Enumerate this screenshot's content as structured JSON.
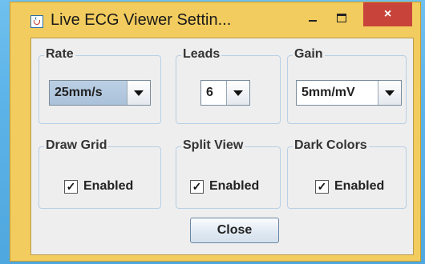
{
  "window": {
    "title": "Live ECG Viewer Settin...",
    "close_glyph": "×",
    "buttons": [
      "minimize-icon",
      "maximize-icon",
      "close-icon"
    ]
  },
  "groups": {
    "rate": {
      "label": "Rate",
      "value": "25mm/s"
    },
    "leads": {
      "label": "Leads",
      "value": "6"
    },
    "gain": {
      "label": "Gain",
      "value": "5mm/mV"
    },
    "draw_grid": {
      "label": "Draw Grid",
      "checkbox_label": "Enabled",
      "checked": true
    },
    "split_view": {
      "label": "Split View",
      "checkbox_label": "Enabled",
      "checked": true
    },
    "dark_colors": {
      "label": "Dark Colors",
      "checkbox_label": "Enabled",
      "checked": true
    }
  },
  "check_glyph": "✓",
  "footer": {
    "close_label": "Close"
  },
  "colors": {
    "frame": "#f2cc5e",
    "close_button": "#c8443b",
    "client_bg": "#eeeeee"
  }
}
